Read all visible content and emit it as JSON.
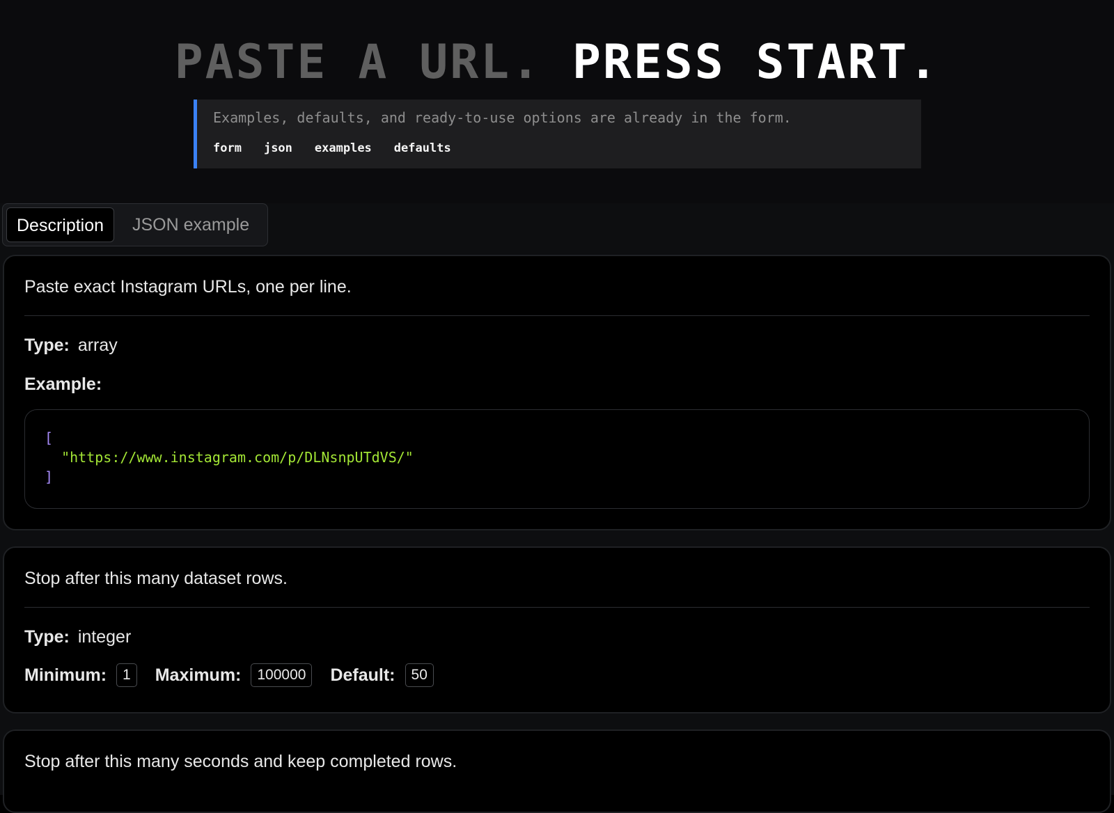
{
  "hero": {
    "title_dim": "PASTE A URL.",
    "title_bright": "PRESS START.",
    "callout_text": "Examples, defaults, and ready-to-use options are already in the form.",
    "tags": [
      "form",
      "json",
      "examples",
      "defaults"
    ]
  },
  "colors": {
    "accent": "#3b82f6",
    "code_bracket": "#a78bfa",
    "code_string": "#a3e635"
  },
  "tabs": {
    "active": "Description",
    "inactive": "JSON example"
  },
  "cards": [
    {
      "description": "Paste exact Instagram URLs, one per line.",
      "type_label": "Type:",
      "type_value": "array",
      "example_label": "Example:",
      "example_open": "[",
      "example_item": "\"https://www.instagram.com/p/DLNsnpUTdVS/\"",
      "example_close": "]"
    },
    {
      "description": "Stop after this many dataset rows.",
      "type_label": "Type:",
      "type_value": "integer",
      "minimum_label": "Minimum:",
      "minimum_value": "1",
      "maximum_label": "Maximum:",
      "maximum_value": "100000",
      "default_label": "Default:",
      "default_value": "50"
    },
    {
      "description": "Stop after this many seconds and keep completed rows."
    }
  ]
}
